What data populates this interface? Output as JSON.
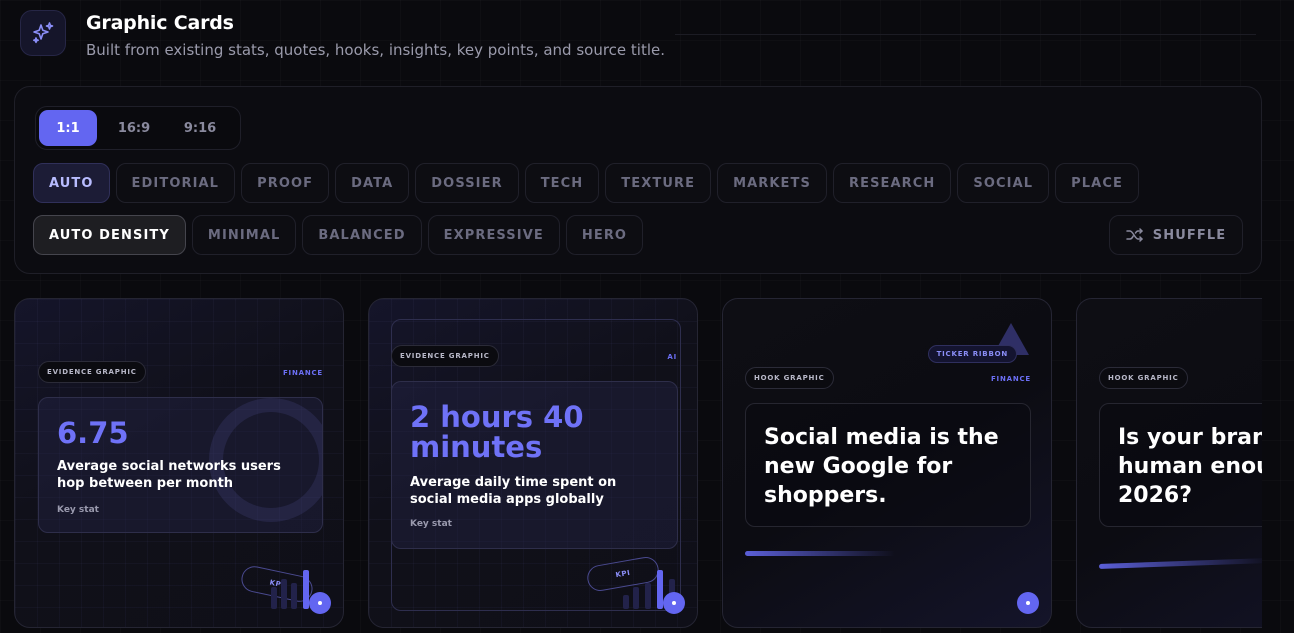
{
  "header": {
    "title": "Graphic Cards",
    "subtitle": "Built from existing stats, quotes, hooks, insights, key points, and source title."
  },
  "ratios": [
    "1:1",
    "16:9",
    "9:16"
  ],
  "styles": [
    "AUTO",
    "EDITORIAL",
    "PROOF",
    "DATA",
    "DOSSIER",
    "TECH",
    "TEXTURE",
    "MARKETS",
    "RESEARCH",
    "SOCIAL",
    "PLACE"
  ],
  "densities": [
    "AUTO DENSITY",
    "MINIMAL",
    "BALANCED",
    "EXPRESSIVE",
    "HERO"
  ],
  "shuffle_label": "SHUFFLE",
  "cards": [
    {
      "type_label": "EVIDENCE GRAPHIC",
      "tag": "FINANCE",
      "stat": "6.75",
      "description": "Average social networks users hop between per month",
      "note": "Key stat",
      "kpi": "KPI"
    },
    {
      "type_label": "EVIDENCE GRAPHIC",
      "tag": "AI",
      "stat": "2 hours 40 minutes",
      "description": "Average daily time spent on social media apps globally",
      "note": "Key stat",
      "kpi": "KPI"
    },
    {
      "type_label": "HOOK GRAPHIC",
      "tag": "FINANCE",
      "ribbon": "TICKER RIBBON",
      "line1": "Social media is the",
      "line2": "new Google for",
      "line3": "shoppers."
    },
    {
      "type_label": "HOOK GRAPHIC",
      "line1": "Is your brand",
      "line2": "human enough in",
      "line3": "2026?"
    }
  ],
  "colors": {
    "accent": "#6366f1",
    "background": "#0a0a0e"
  }
}
